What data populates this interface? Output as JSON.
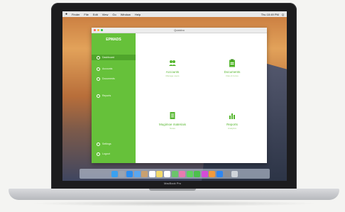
{
  "laptop": {
    "model_label": "MacBook Pro"
  },
  "menubar": {
    "apple_icon": "apple-icon",
    "items": [
      "Finder",
      "File",
      "Edit",
      "View",
      "Go",
      "Window",
      "Help"
    ],
    "status": [
      "Thu 10:49 PM",
      "Q"
    ]
  },
  "app": {
    "window_title": "Quickbo",
    "brand": "EPMADS",
    "sidebar": {
      "items": [
        {
          "label": "Dashboard",
          "active": true
        },
        {
          "label": "Accounts",
          "active": false
        },
        {
          "label": "Documents",
          "active": false
        },
        {
          "label": "Reports",
          "active": false
        },
        {
          "label": "Settings",
          "active": false
        },
        {
          "label": "Logout",
          "active": false
        }
      ]
    },
    "tiles": [
      {
        "label": "Accounts",
        "sub": "Manage users",
        "icon": "people-icon"
      },
      {
        "label": "Documents",
        "sub": "Files & forms",
        "icon": "clipboard-icon"
      },
      {
        "label": "Mugimoe materiais",
        "sub": "Notes",
        "icon": "document-icon"
      },
      {
        "label": "Reports",
        "sub": "Analytics",
        "icon": "bar-chart-icon"
      }
    ]
  },
  "dock": {
    "apps": [
      "finder-icon",
      "launchpad-icon",
      "safari-icon",
      "mail-icon",
      "contacts-icon",
      "calendar-icon",
      "notes-icon",
      "reminders-icon",
      "maps-icon",
      "photos-icon",
      "messages-icon",
      "facetime-icon",
      "itunes-icon",
      "ibooks-icon",
      "appstore-icon",
      "settings-icon",
      "trash-icon"
    ],
    "colors": [
      "#3aa0f0",
      "#9aa3b0",
      "#2b8ef0",
      "#5aa6f0",
      "#c9a070",
      "#ffffff",
      "#f2d96a",
      "#ffffff",
      "#6bc46b",
      "#e87ab0",
      "#5fd05f",
      "#4cc04c",
      "#d54bd8",
      "#f29a3a",
      "#2e86f0",
      "#8c8f96",
      "#cfd4da"
    ]
  },
  "colors": {
    "accent": "#66c13a",
    "accent_dark": "#4fa52b"
  }
}
